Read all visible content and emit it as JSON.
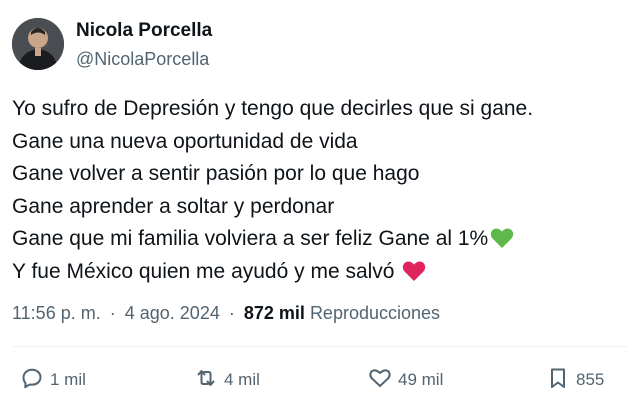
{
  "tweet": {
    "author": {
      "name": "Nicola Porcella",
      "handle": "@NicolaPorcella"
    },
    "lines": [
      "Yo sufro de Depresión y tengo que decirles que si gane.",
      "Gane una nueva oportunidad de vida",
      "Gane volver a sentir pasión por lo que hago",
      "Gane aprender a soltar y perdonar",
      "Gane que mi familia volviera a ser feliz  Gane al 1%",
      "Y fue México quien me ayudó y me salvó"
    ],
    "emojis": {
      "green_heart": "green-heart-icon",
      "red_heart": "red-heart-icon"
    },
    "meta": {
      "time": "11:56 p. m.",
      "separator": "·",
      "date": "4 ago. 2024",
      "views_count": "872 mil",
      "views_label": "Reproducciones"
    },
    "actions": {
      "replies": "1 mil",
      "retweets": "4 mil",
      "likes": "49 mil",
      "bookmarks": "855"
    }
  },
  "colors": {
    "text": "#0f1419",
    "secondary": "#536471",
    "green_heart": "#5fb94a",
    "red_heart": "#e0245e"
  }
}
